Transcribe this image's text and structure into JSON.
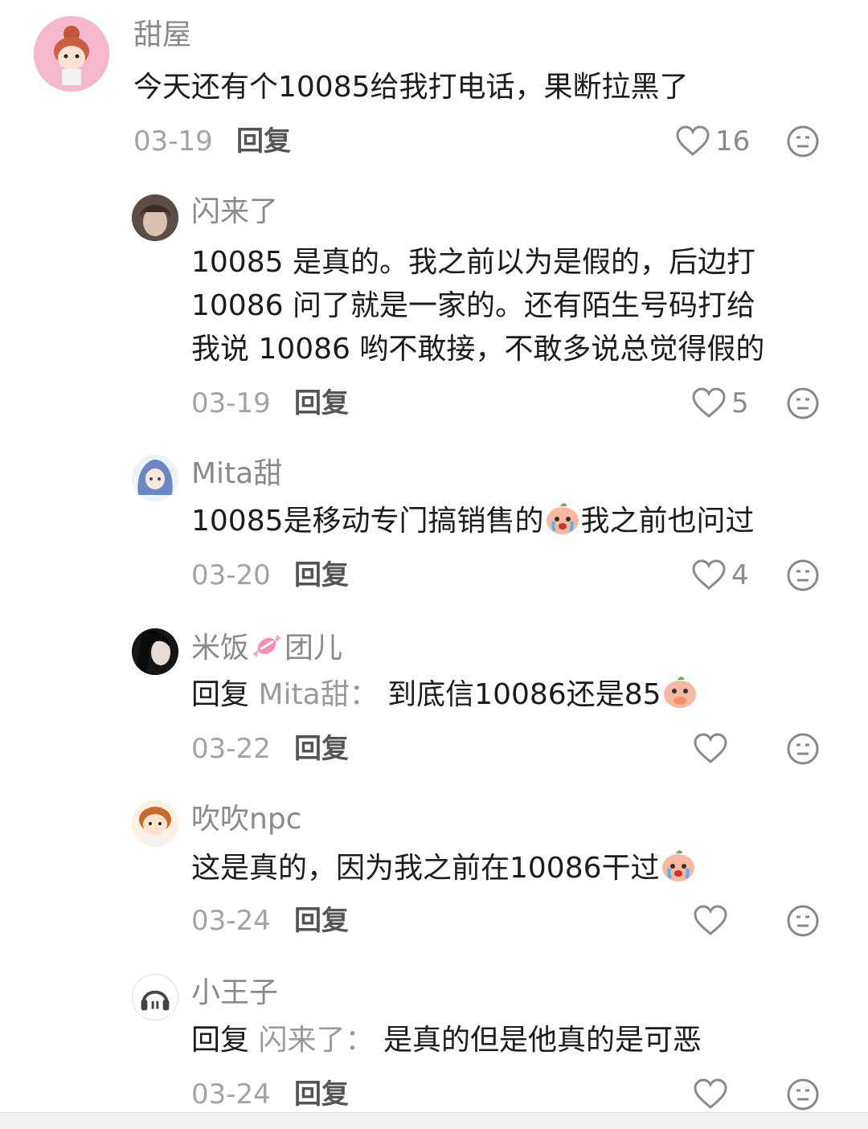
{
  "comments": [
    {
      "name": "甜屋",
      "text": "今天还有个10085给我打电话，果断拉黑了",
      "date": "03-19",
      "reply": "回复",
      "likes": "16"
    },
    {
      "name": "闪来了",
      "lines": [
        "10085 是真的。我之前以为是假的，后边打",
        "10086 问了就是一家的。还有陌生号码打给",
        "我说 10086 哟不敢接，不敢多说总觉得假的"
      ],
      "date": "03-19",
      "reply": "回复",
      "likes": "5"
    },
    {
      "name": "Mita甜",
      "text_a": "10085是移动专门搞销售的",
      "text_b": "我之前也问过",
      "date": "03-20",
      "reply": "回复",
      "likes": "4"
    },
    {
      "name_a": "米饭",
      "name_b": "团儿",
      "reply_prefix": "回复",
      "reply_target": "Mita甜：",
      "text": "到底信10086还是85",
      "date": "03-22",
      "reply": "回复",
      "likes": ""
    },
    {
      "name": "吹吹npc",
      "text": "这是真的，因为我之前在10086干过",
      "date": "03-24",
      "reply": "回复",
      "likes": ""
    },
    {
      "name": "小王子",
      "reply_prefix": "回复",
      "reply_target": "闪来了：",
      "text": "是真的但是他真的是可恶",
      "date": "03-24",
      "reply": "回复",
      "likes": ""
    }
  ],
  "icons": {
    "like": "heart-outline-icon",
    "dislike": "neutral-face-icon",
    "sticker": "crying-peach-sticker"
  },
  "colors": {
    "name": "#8a8a8a",
    "text": "#1c1c1c",
    "meta": "#a3a3a3",
    "reply_target": "#9a9a9a"
  }
}
